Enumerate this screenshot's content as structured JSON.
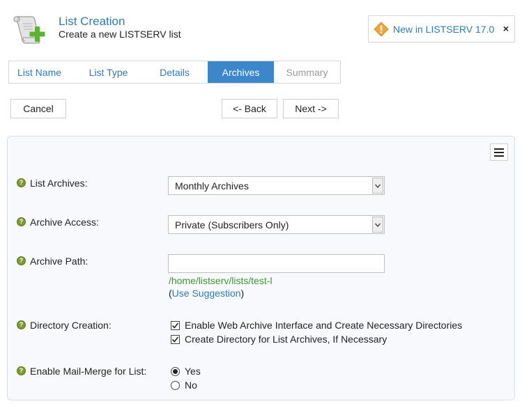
{
  "header": {
    "title": "List Creation",
    "subtitle": "Create a new LISTSERV list",
    "whatsnew_label": "New in LISTSERV 17.0",
    "close_label": "×"
  },
  "tabs": [
    {
      "label": "List Name",
      "state": "link"
    },
    {
      "label": "List Type",
      "state": "link"
    },
    {
      "label": "Details",
      "state": "link"
    },
    {
      "label": "Archives",
      "state": "active"
    },
    {
      "label": "Summary",
      "state": "disabled"
    }
  ],
  "buttons": {
    "cancel": "Cancel",
    "back": "<- Back",
    "next": "Next ->"
  },
  "form": {
    "list_archives": {
      "label": "List Archives:",
      "value": "Monthly Archives"
    },
    "archive_access": {
      "label": "Archive Access:",
      "value": "Private (Subscribers Only)"
    },
    "archive_path": {
      "label": "Archive Path:",
      "value": "",
      "hint": "/home/listserv/lists/test-l",
      "suggest_open": "(",
      "suggest_link": "Use Suggestion",
      "suggest_close": ")"
    },
    "directory_creation": {
      "label": "Directory Creation:",
      "options": [
        {
          "label": "Enable Web Archive Interface and Create Necessary Directories",
          "checked": true
        },
        {
          "label": "Create Directory for List Archives, If Necessary",
          "checked": true
        }
      ]
    },
    "mail_merge": {
      "label": "Enable Mail-Merge for List:",
      "options": [
        {
          "label": "Yes",
          "selected": true
        },
        {
          "label": "No",
          "selected": false
        }
      ]
    }
  },
  "help_glyph": "?",
  "colors": {
    "accent": "#2f7ab8",
    "active_tab": "#3b87c9",
    "hint_green": "#3a9a2a",
    "help_green": "#7c9a2e"
  }
}
